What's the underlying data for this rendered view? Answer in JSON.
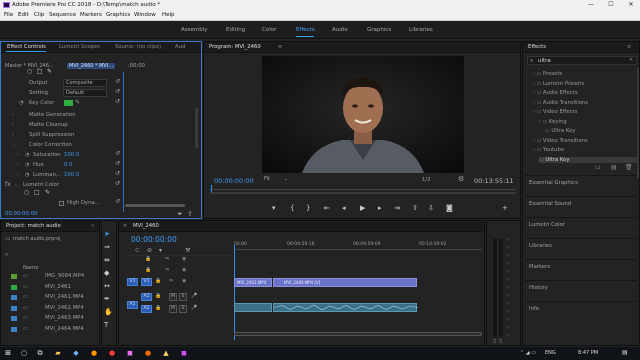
{
  "window": {
    "title": "Adobe Premiere Pro CC 2018 - D:\\Temp\\match audio *",
    "controls": [
      "—",
      "☐",
      "✕"
    ]
  },
  "menu": [
    "File",
    "Edit",
    "Clip",
    "Sequence",
    "Markers",
    "Graphics",
    "Window",
    "Help"
  ],
  "workspaces": [
    "Assembly",
    "Editing",
    "Color",
    "Effects",
    "Audio",
    "Graphics",
    "Libraries"
  ],
  "workspace_active": "Effects",
  "effect_controls": {
    "tabs": [
      "Effect Controls",
      "Lumetri Scopes",
      "Source: (no clips)",
      "Aud"
    ],
    "master": "Master * MVI_246...",
    "seq": "MVI_2460 * MVI...",
    "mini_time": ":00:00",
    "output_label": "Output",
    "output_value": "Composite",
    "setting_label": "Setting",
    "setting_value": "Default",
    "keycolor_label": "Key Color",
    "rows": [
      "Matte Generation",
      "Matte Cleanup",
      "Spill Suppression",
      "Color Correction"
    ],
    "saturation_label": "Saturation",
    "saturation_value": "100.0",
    "hue_label": "Hue",
    "hue_value": "0.0",
    "luminance_label": "Luminan...",
    "luminance_value": "100.0",
    "lumetri_label": "Lumetri Color",
    "highdyn_label": "High Dyna...",
    "timecode": "00:00:00:00"
  },
  "program": {
    "title": "Program: MVI_2460",
    "timecode_left": "00:00:00:00",
    "fit": "Fit",
    "fraction": "1/2",
    "timecode_right": "00:13:55:11"
  },
  "effects_panel": {
    "title": "Effects",
    "search": "ultra",
    "tree": [
      {
        "label": "Presets",
        "indent": 1
      },
      {
        "label": "Lumetri Presets",
        "indent": 1
      },
      {
        "label": "Audio Effects",
        "indent": 1
      },
      {
        "label": "Audio Transitions",
        "indent": 1
      },
      {
        "label": "Video Effects",
        "indent": 1
      },
      {
        "label": "Keying",
        "indent": 2
      },
      {
        "label": "Ultra Key",
        "indent": 3
      },
      {
        "label": "Video Transitions",
        "indent": 1
      },
      {
        "label": "Youtube",
        "indent": 1
      },
      {
        "label": "Ultra Key",
        "indent": 2,
        "selected": true
      }
    ],
    "sections": [
      "Essential Graphics",
      "Essential Sound",
      "Lumetri Color",
      "Libraries",
      "Markers",
      "History",
      "Info"
    ]
  },
  "project": {
    "title": "Project: match audio",
    "file": "match audio.prproj",
    "col": "Name",
    "items": [
      {
        "name": "IMG_9084.MP4",
        "color": "#5a9b35"
      },
      {
        "name": "MVI_2461",
        "color": "#2eab49"
      },
      {
        "name": "MVI_2461.MP4",
        "color": "#3c80c8"
      },
      {
        "name": "MVI_2462.MP4",
        "color": "#3c80c8"
      },
      {
        "name": "MVI_2463.MP4",
        "color": "#3c80c8"
      },
      {
        "name": "MVI_2464.MP4",
        "color": "#3c80c8"
      }
    ]
  },
  "timeline": {
    "tab": "MVI_2460",
    "timecode": "00:00:00:00",
    "ruler": [
      "00:00",
      "00:04:59:16",
      "00:09:59:09",
      "00:14:59:02"
    ],
    "tracks_v": [
      "V1"
    ],
    "tracks_a": [
      "A1",
      "A2"
    ],
    "clip_v1": "MVI_2460.MP4 [V]",
    "clip_v2": "MVI_2460.MP4 [V]",
    "clip_v_prefix": "MVI_2461.MP4"
  },
  "taskbar": {
    "time": "8:47 PM",
    "lang": "ENG"
  }
}
